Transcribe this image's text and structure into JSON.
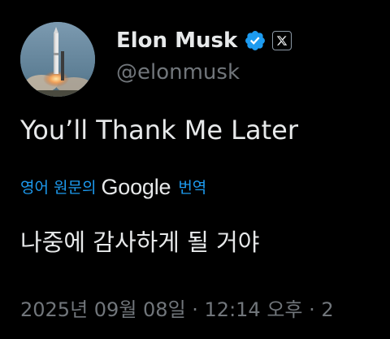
{
  "author": {
    "display_name": "Elon Musk",
    "handle": "@elonmusk",
    "verified_icon": "verified-badge-icon",
    "affiliation_icon": "x-logo-icon",
    "avatar_icon": "rocket-launch-avatar"
  },
  "tweet": {
    "text": "You’ll Thank Me Later",
    "translate_prefix": "영어 원문의",
    "translate_brand": "Google",
    "translate_action": "번역",
    "translated_text": "나중에 감사하게 될 거야",
    "timestamp": "2025년 09월 08일 · 12:14 오후 · 2"
  },
  "colors": {
    "background": "#000000",
    "primary_text": "#e7e9ea",
    "secondary_text": "#71767b",
    "link_blue": "#1d9bf0",
    "verified_blue": "#1d9bf0"
  }
}
